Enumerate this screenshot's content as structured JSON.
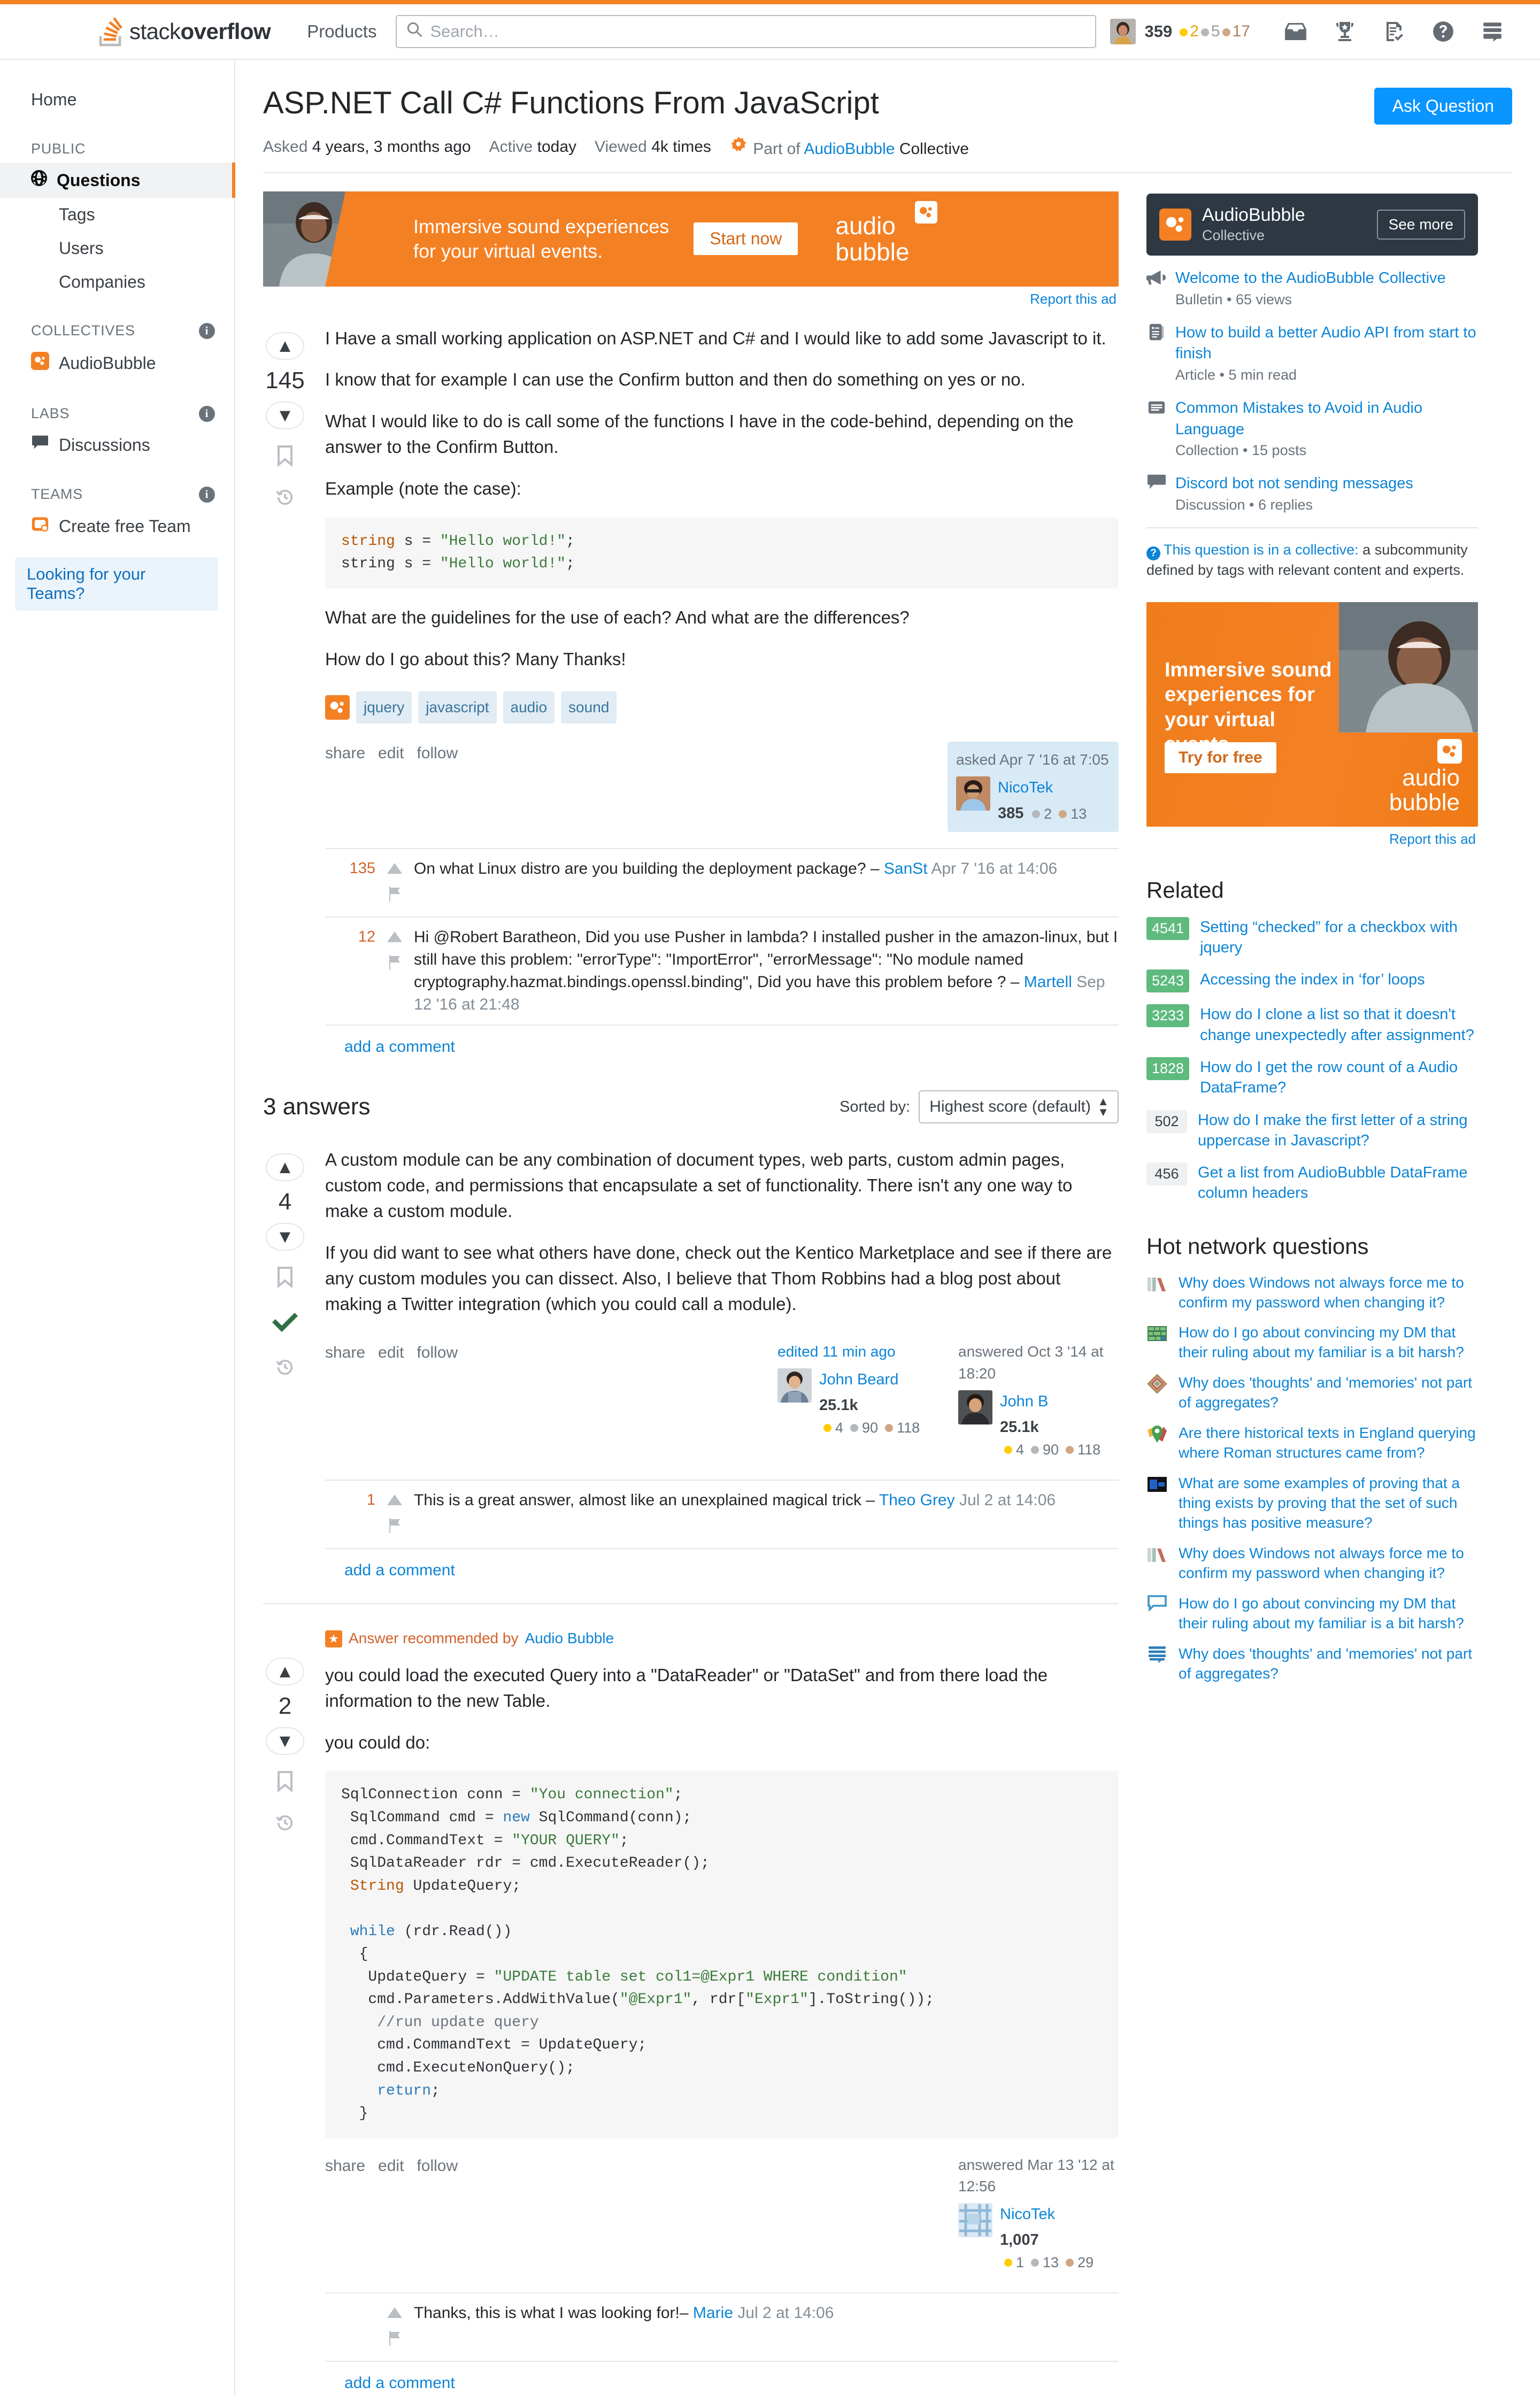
{
  "header": {
    "logo_text_light": "stack",
    "logo_text_bold": "overflow",
    "products": "Products",
    "search_placeholder": "Search…",
    "user": {
      "reputation": "359",
      "gold": "2",
      "silver": "5",
      "bronze": "17"
    },
    "icons": [
      "inbox-icon",
      "trophy-icon",
      "review-icon",
      "help-icon",
      "stacks-icon"
    ]
  },
  "sidebar": {
    "home": "Home",
    "sections": [
      {
        "heading": "PUBLIC",
        "has_info": false,
        "items": [
          {
            "label": "Questions",
            "icon": "globe-icon",
            "active": true
          },
          {
            "label": "Tags",
            "active": false
          },
          {
            "label": "Users",
            "active": false
          },
          {
            "label": "Companies",
            "active": false
          }
        ]
      },
      {
        "heading": "COLLECTIVES",
        "has_info": true,
        "items": [
          {
            "label": "AudioBubble",
            "icon": "audiobubble-icon"
          }
        ]
      },
      {
        "heading": "LABS",
        "has_info": true,
        "items": [
          {
            "label": "Discussions",
            "icon": "discussion-icon"
          }
        ]
      },
      {
        "heading": "TEAMS",
        "has_info": true,
        "items": [
          {
            "label": "Create free Team",
            "icon": "team-icon"
          }
        ]
      }
    ],
    "teams_cta": "Looking for your Teams?"
  },
  "question": {
    "title": "ASP.NET Call C# Functions From JavaScript",
    "ask_button": "Ask Question",
    "meta": {
      "asked_label": "Asked",
      "asked_value": "4 years, 3 months ago",
      "active_label": "Active",
      "active_value": "today",
      "viewed_label": "Viewed",
      "viewed_value": "4k times",
      "collective_prefix": "Part of",
      "collective_name": "AudioBubble",
      "collective_suffix": "Collective"
    },
    "score": "145",
    "paragraphs": [
      "I Have a small working application on ASP.NET and C# and I would like to add some Javascript to it.",
      "I know that for example I can use the Confirm button and then do something on yes or no.",
      "What I would like to do is call some of the functions I have in the code-behind, depending on the answer to the Confirm Button.",
      "Example (note the case):"
    ],
    "code": "string s = \"Hello world!\";\nstring s = \"Hello world!\";",
    "paragraphs_after": [
      "What are the guidelines for the use of each? And what are the differences?",
      "How do I go about this? Many Thanks!"
    ],
    "tags": [
      "jquery",
      "javascript",
      "audio",
      "sound"
    ],
    "actions": [
      "share",
      "edit",
      "follow"
    ],
    "author": {
      "when": "asked Apr 7 '16 at 7:05",
      "name": "NicoTek",
      "reputation": "385",
      "silver": "2",
      "bronze": "13"
    },
    "comments": [
      {
        "score": "135",
        "text": "On what Linux distro are you building the deployment package?",
        "dash": "–",
        "user": "SanSt",
        "date": "Apr 7 '16 at 14:06"
      },
      {
        "score": "12",
        "text": "Hi @Robert Baratheon, Did you use Pusher in lambda? I installed pusher in the amazon-linux, but I still have this problem: \"errorType\": \"ImportError\",  \"errorMessage\": \"No module named cryptography.hazmat.bindings.openssl.binding\", Did you have this problem before ?",
        "dash": "–",
        "user": "Martell",
        "date": "Sep 12 '16 at 21:48"
      }
    ],
    "add_comment": "add a comment"
  },
  "ads": {
    "banner": {
      "line1": "Immersive sound experiences",
      "line2": "for your virtual events.",
      "button": "Start now",
      "logo_line1": "audio",
      "logo_line2": "bubble",
      "report": "Report this ad"
    },
    "sidebar": {
      "text": "Immersive sound experiences for your virtual events.",
      "button": "Try for free",
      "logo_line1": "audio",
      "logo_line2": "bubble",
      "report": "Report this ad"
    }
  },
  "answers_section": {
    "count_label": "3 answers",
    "sorted_by_label": "Sorted by:",
    "sort_value": "Highest score (default)"
  },
  "answers": [
    {
      "score": "4",
      "accepted": true,
      "recommended": null,
      "paragraphs": [
        "A custom module can be any combination of document types, web parts, custom admin pages, custom code, and permissions that encapsulate a set of functionality. There isn't any one way to make a custom module.",
        "If you did want to see what others have done, check out the Kentico Marketplace and see if there are any custom modules you can dissect. Also, I believe that Thom Robbins had a blog post about making a Twitter integration (which you could call a module)."
      ],
      "code": null,
      "actions": [
        "share",
        "edit",
        "follow"
      ],
      "editor": {
        "when": "edited 11 min ago",
        "name": "John Beard",
        "reputation": "25.1k",
        "gold": "4",
        "silver": "90",
        "bronze": "118"
      },
      "author": {
        "when": "answered Oct 3 '14 at 18:20",
        "name": "John B",
        "reputation": "25.1k",
        "gold": "4",
        "silver": "90",
        "bronze": "118"
      },
      "comments": [
        {
          "score": "1",
          "text": "This is a great answer, almost like an unexplained magical trick",
          "dash": "–",
          "user": "Theo Grey",
          "date": "Jul 2 at 14:06"
        }
      ],
      "add_comment": "add a comment"
    },
    {
      "score": "2",
      "accepted": false,
      "recommended": {
        "prefix": "Answer recommended by",
        "by": "Audio Bubble"
      },
      "paragraphs": [
        "you could load the executed Query into a \"DataReader\" or \"DataSet\" and from there load the information to the new Table.",
        "you could do:"
      ],
      "code": "SqlConnection conn = \"You connection\";\n SqlCommand cmd = new SqlCommand(conn);\n cmd.CommandText = \"YOUR QUERY\";\n SqlDataReader rdr = cmd.ExecuteReader();\n String UpdateQuery;\n\n while (rdr.Read())\n  {\n   UpdateQuery = \"UPDATE table set col1=@Expr1 WHERE condition\"\n   cmd.Parameters.AddWithValue(\"@Expr1\", rdr[\"Expr1\"].ToString());\n    //run update query\n    cmd.CommandText = UpdateQuery;\n    cmd.ExecuteNonQuery();\n    return;\n  }",
      "actions": [
        "share",
        "edit",
        "follow"
      ],
      "editor": null,
      "author": {
        "when": "answered Mar 13 '12 at 12:56",
        "name": "NicoTek",
        "reputation": "1,007",
        "gold": "1",
        "silver": "13",
        "bronze": "29"
      },
      "comments": [
        {
          "score": "",
          "text": "Thanks, this is what I was looking for!",
          "dash": "–",
          "user": "Marie",
          "date": "Jul 2 at 14:06"
        }
      ],
      "add_comment": "add a comment"
    }
  ],
  "right": {
    "collective": {
      "name": "AudioBubble",
      "subtitle": "Collective",
      "see_more": "See more",
      "items": [
        {
          "title": "Welcome to the AudioBubble Collective",
          "meta": "Bulletin • 65 views",
          "icon": "megaphone-icon"
        },
        {
          "title": "How to build a better Audio API from start to finish",
          "meta": "Article • 5 min read",
          "icon": "article-icon"
        },
        {
          "title": "Common Mistakes to Avoid in Audio Language",
          "meta": "Collection • 15 posts",
          "icon": "collection-icon"
        },
        {
          "title": "Discord bot not sending messages",
          "meta": "Discussion • 6 replies",
          "icon": "discussion-icon"
        }
      ]
    },
    "notice": {
      "link_text": "This question is in a collective:",
      "rest": " a subcommunity defined by tags with relevant content and experts."
    },
    "related_title": "Related",
    "related": [
      {
        "score": "4541",
        "green": true,
        "title": "Setting “checked” for a checkbox with jquery"
      },
      {
        "score": "5243",
        "green": true,
        "title": "Accessing the index in ‘for’ loops"
      },
      {
        "score": "3233",
        "green": true,
        "title": "How do I clone a list so that it doesn't change unexpectedly after assignment?"
      },
      {
        "score": "1828",
        "green": true,
        "title": "How do I get the row count of a Audio DataFrame?"
      },
      {
        "score": "502",
        "green": false,
        "title": "How do I make the first letter of a string uppercase in Javascript?"
      },
      {
        "score": "456",
        "green": false,
        "title": "Get a list from AudioBubble DataFrame column headers"
      }
    ],
    "hot_title": "Hot network questions",
    "hot": [
      {
        "title": "Why does Windows not always force me to confirm my password when changing it?",
        "icon": "superuser-icon"
      },
      {
        "title": "How do I go about convincing my DM that their ruling about my familiar is a bit harsh?",
        "icon": "rpg-icon"
      },
      {
        "title": "Why does 'thoughts' and 'memories' not part of aggregates?",
        "icon": "buddhism-icon"
      },
      {
        "title": "Are there historical texts in England querying where Roman structures came from?",
        "icon": "history-icon"
      },
      {
        "title": "What are some examples of proving that a thing exists by proving that the set of such things has positive measure?",
        "icon": "math-icon"
      },
      {
        "title": "Why does Windows not always force me to confirm my password when changing it?",
        "icon": "superuser-icon"
      },
      {
        "title": "How do I go about convincing my DM that their ruling about my familiar is a bit harsh?",
        "icon": "chat-icon"
      },
      {
        "title": "Why does 'thoughts' and 'memories' not part of aggregates?",
        "icon": "stacks2-icon"
      }
    ]
  }
}
